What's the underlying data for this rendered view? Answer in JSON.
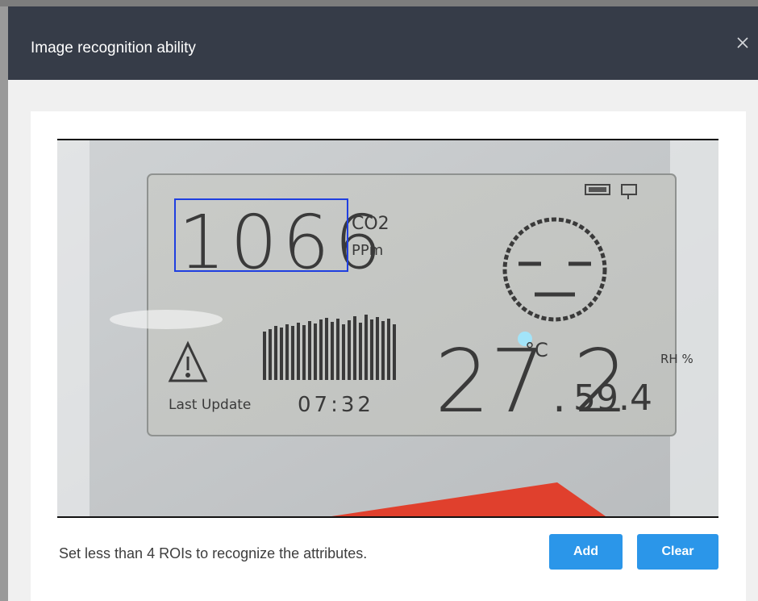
{
  "dialog": {
    "title": "Image recognition ability",
    "close_icon": "close-icon"
  },
  "camera_view": {
    "lcd": {
      "co2_value": "1066",
      "co2_label": "CO2",
      "co2_unit": "PPm",
      "temperature": "27.2",
      "temperature_unit": "°C",
      "humidity": "59.4",
      "humidity_unit": "RH %",
      "last_update_label": "Last Update",
      "last_update_time": "07:32"
    },
    "roi_count": 1
  },
  "footer": {
    "hint": "Set less than 4 ROIs to recognize the attributes.",
    "add_label": "Add",
    "clear_label": "Clear"
  },
  "colors": {
    "header_bg": "#363c48",
    "button_bg": "#2b96e9",
    "roi_border": "#1f3fe0"
  }
}
